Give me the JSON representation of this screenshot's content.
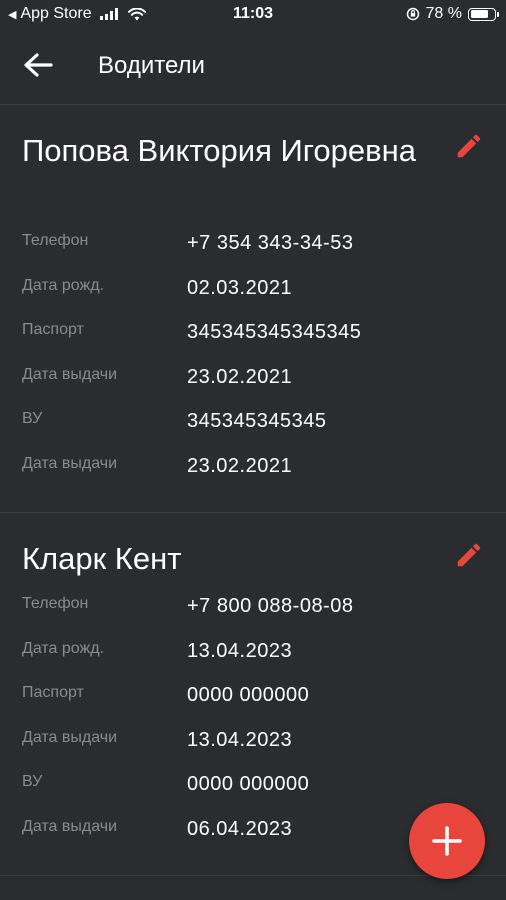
{
  "statusbar": {
    "carrier": "App Store",
    "time": "11:03",
    "battery": "78 %",
    "battery_level": 0.78
  },
  "appbar": {
    "title": "Водители",
    "back_icon": "arrow-left-icon"
  },
  "drivers": [
    {
      "name": "Попова Виктория Игоревна",
      "fields": [
        {
          "label": "Телефон",
          "value": "+7 354 343-34-53"
        },
        {
          "label": "Дата рожд.",
          "value": "02.03.2021"
        },
        {
          "label": "Паспорт",
          "value": "345345345345345"
        },
        {
          "label": "Дата выдачи",
          "value": "23.02.2021"
        },
        {
          "label": "ВУ",
          "value": "345345345345"
        },
        {
          "label": "Дата выдачи",
          "value": "23.02.2021"
        }
      ]
    },
    {
      "name": "Кларк Кент",
      "fields": [
        {
          "label": "Телефон",
          "value": "+7 800 088-08-08"
        },
        {
          "label": "Дата рожд.",
          "value": "13.04.2023"
        },
        {
          "label": "Паспорт",
          "value": "0000 000000"
        },
        {
          "label": "Дата выдачи",
          "value": "13.04.2023"
        },
        {
          "label": "ВУ",
          "value": "0000 000000"
        },
        {
          "label": "Дата выдачи",
          "value": "06.04.2023"
        }
      ]
    }
  ],
  "colors": {
    "accent": "#e8453c",
    "background": "#2b2c2f",
    "label": "#8a8b8e"
  },
  "fab": {
    "icon": "plus-icon"
  }
}
